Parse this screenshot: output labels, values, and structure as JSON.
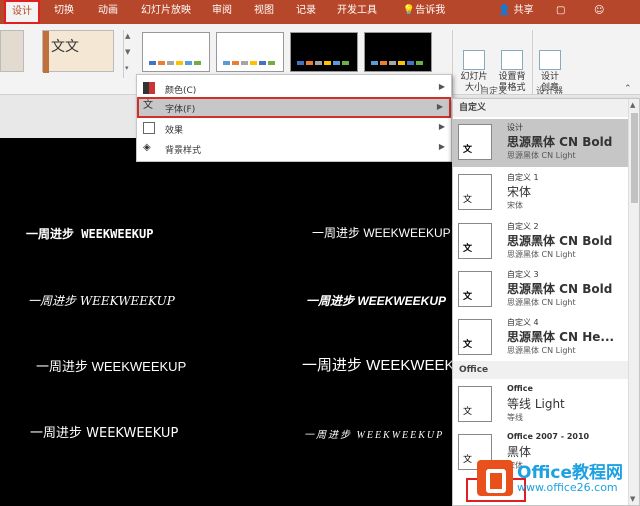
{
  "tabs": [
    {
      "label": "设计",
      "active": true
    },
    {
      "label": "切换"
    },
    {
      "label": "动画"
    },
    {
      "label": "幻灯片放映"
    },
    {
      "label": "审阅"
    },
    {
      "label": "视图"
    },
    {
      "label": "记录"
    },
    {
      "label": "开发工具"
    },
    {
      "label": "告诉我"
    }
  ],
  "share_label": "共享",
  "ribbon": {
    "theme_thumb_text": "文文",
    "variant_colors": [
      "#4472c4",
      "#ed7d31",
      "#a5a5a5",
      "#ffc000",
      "#5b9bd5",
      "#70ad47"
    ],
    "slide_size_label": "幻灯片\n大小",
    "format_bg_label": "设置背\n景格式",
    "design_ideas_label": "设计\n创意",
    "group_custom": "自定义",
    "group_designer": "设计器"
  },
  "menu": {
    "items": [
      {
        "label": "颜色(C)"
      },
      {
        "label": "字体(F)",
        "selected": true
      },
      {
        "label": "效果"
      },
      {
        "label": "背景样式"
      }
    ]
  },
  "flyout": {
    "section_custom": "自定义",
    "section_office": "Office",
    "thumb_big": "文",
    "thumb_small": "文",
    "items": [
      {
        "name": "设计",
        "heading": "思源黑体 CN Bold",
        "body": "思源黑体 CN Light",
        "selected": true,
        "bold": true
      },
      {
        "name": "自定义 1",
        "heading": "宋体",
        "body": "宋体",
        "bold": false
      },
      {
        "name": "自定义 2",
        "heading": "思源黑体 CN Bold",
        "body": "思源黑体 CN Light",
        "bold": true
      },
      {
        "name": "自定义 3",
        "heading": "思源黑体 CN Bold",
        "body": "思源黑体 CN Light",
        "bold": true
      },
      {
        "name": "自定义 4",
        "heading": "思源黑体 CN He...",
        "body": "思源黑体 CN Light",
        "bold": true
      },
      {
        "name": "Office",
        "heading": "等线 Light",
        "body": "等线",
        "bold": false
      },
      {
        "name": "Office 2007 - 2010",
        "heading": "黑体",
        "body": "宋体",
        "bold": false
      }
    ]
  },
  "slide": {
    "samples": [
      {
        "text": "一周进步 WEEKWEEKUP"
      },
      {
        "text": "一周进步 WEEKWEEKUP"
      },
      {
        "text": "一周进步 WEEKWEEKUP"
      },
      {
        "text": "一周进步 WEEKWEEKUP"
      },
      {
        "text": "一周进步 WEEKWEEKUP"
      },
      {
        "text": "一周进步 WEEKWEEKUP"
      },
      {
        "text": "一周进步 WEEKWEEKUP"
      },
      {
        "text": "一周进步 WEEKWEEKUP"
      }
    ]
  },
  "watermark": {
    "title": "Office教程网",
    "url": "www.office26.com"
  }
}
